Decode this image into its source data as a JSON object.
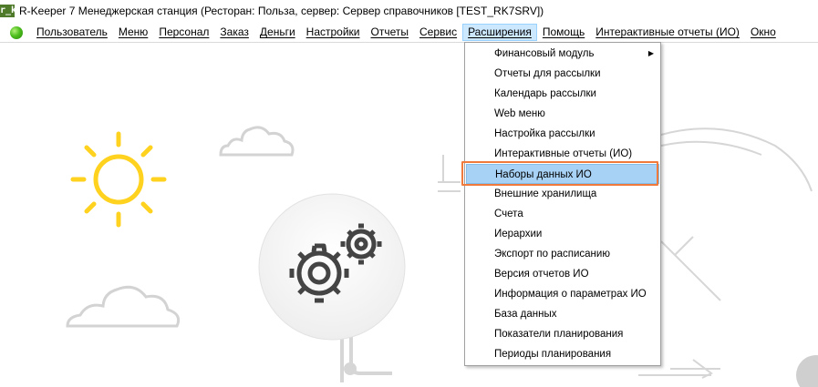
{
  "window": {
    "icon_text": "r_k",
    "title": "R-Keeper 7 Менеджерская станция (Ресторан: Польза, сервер: Сервер справочников [TEST_RK7SRV])"
  },
  "menubar": {
    "items": [
      "Пользователь",
      "Меню",
      "Персонал",
      "Заказ",
      "Деньги",
      "Настройки",
      "Отчеты",
      "Сервис",
      "Расширения",
      "Помощь",
      "Интерактивные отчеты (ИО)",
      "Окно"
    ],
    "active_index": 8
  },
  "dropdown": {
    "items": [
      "Финансовый модуль",
      "Отчеты для рассылки",
      "Календарь рассылки",
      "Web меню",
      "Настройка рассылки",
      "Интерактивные отчеты (ИО)",
      "Наборы данных ИО",
      "Внешние хранилища",
      "Счета",
      "Иерархии",
      "Экспорт по расписанию",
      "Версия отчетов ИО",
      "Информация о параметрах ИО",
      "База данных",
      "Показатели планирования",
      "Периоды планирования"
    ],
    "highlighted_index": 6,
    "submenu_index": 0
  },
  "colors": {
    "sun": "#ffd21f",
    "line_art": "#d0d0d0",
    "highlight": "#a8d2f5",
    "callout": "#f07a3c",
    "status_dot": "#4cbe1c"
  }
}
